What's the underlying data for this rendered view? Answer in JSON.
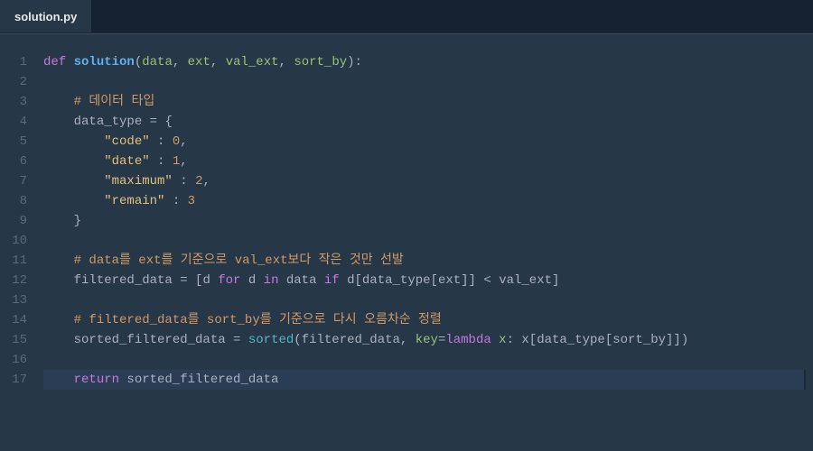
{
  "tab": {
    "filename": "solution.py"
  },
  "editor": {
    "highlight_line": 17,
    "tokens": {
      "l1": {
        "def": "def ",
        "fn": "solution",
        "p_open": "(",
        "p1": "data",
        "c1": ", ",
        "p2": "ext",
        "c2": ", ",
        "p3": "val_ext",
        "c3": ", ",
        "p4": "sort_by",
        "p_close": "):"
      },
      "l3": {
        "indent": "    ",
        "comm": "# 데이터 타입"
      },
      "l4": {
        "indent": "    ",
        "var": "data_type",
        "eq": " = ",
        "brace": "{"
      },
      "l5": {
        "indent": "        ",
        "key": "\"code\"",
        "colon": " : ",
        "val": "0",
        "comma": ","
      },
      "l6": {
        "indent": "        ",
        "key": "\"date\"",
        "colon": " : ",
        "val": "1",
        "comma": ","
      },
      "l7": {
        "indent": "        ",
        "key": "\"maximum\"",
        "colon": " : ",
        "val": "2",
        "comma": ","
      },
      "l8": {
        "indent": "        ",
        "key": "\"remain\"",
        "colon": " : ",
        "val": "3"
      },
      "l9": {
        "indent": "    ",
        "brace": "}"
      },
      "l11": {
        "indent": "    ",
        "comm": "# data를 ext를 기준으로 val_ext보다 작은 것만 선발"
      },
      "l12": {
        "indent": "    ",
        "var": "filtered_data",
        "eq": " = [",
        "d1": "d",
        "for": " for ",
        "d2": "d",
        "in": " in ",
        "data": "data",
        "iff": " if ",
        "d3": "d",
        "br1": "[",
        "dt": "data_type",
        "br2": "[",
        "ext": "ext",
        "br3": "]]",
        "lt": " < ",
        "ve": "val_ext",
        "close": "]"
      },
      "l14": {
        "indent": "    ",
        "comm": "# filtered_data를 sort_by를 기준으로 다시 오름차순 정렬"
      },
      "l15": {
        "indent": "    ",
        "var": "sorted_filtered_data",
        "eq": " = ",
        "sorted": "sorted",
        "open": "(",
        "fd": "filtered_data",
        "c1": ", ",
        "key": "key",
        "eq2": "=",
        "lam": "lambda ",
        "x": "x",
        "col": ": ",
        "x2": "x",
        "br1": "[",
        "dt": "data_type",
        "br2": "[",
        "sb": "sort_by",
        "br3": "]])"
      },
      "l17": {
        "indent": "    ",
        "ret": "return ",
        "var": "sorted_filtered_data"
      }
    },
    "line_numbers": [
      "1",
      "2",
      "3",
      "4",
      "5",
      "6",
      "7",
      "8",
      "9",
      "10",
      "11",
      "12",
      "13",
      "14",
      "15",
      "16",
      "17"
    ]
  }
}
